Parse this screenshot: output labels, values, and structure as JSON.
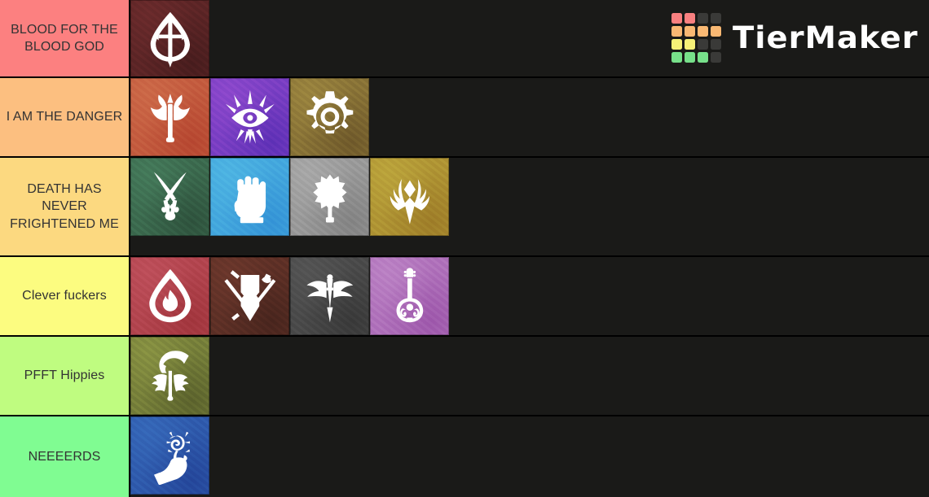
{
  "app": {
    "name": "TierMaker",
    "background_color": "#1a1a18",
    "logo_grid_colors": [
      "#f98080",
      "#f98080",
      "#3a3a38",
      "#3a3a38",
      "#f9b873",
      "#f9b873",
      "#f9b873",
      "#f9b873",
      "#f6f177",
      "#f6f177",
      "#3a3a38",
      "#3a3a38",
      "#77e08a",
      "#77e08a",
      "#77e08a",
      "#3a3a38"
    ]
  },
  "tiers": [
    {
      "label": "BLOOD FOR THE BLOOD GOD",
      "color": "#fc8080",
      "items": [
        {
          "name": "barbarian",
          "bg": "#5d2526",
          "icon": "barbarian"
        }
      ]
    },
    {
      "label": "I AM THE DANGER",
      "color": "#fcbf80",
      "items": [
        {
          "name": "fighter-axe",
          "bg": "#c45c3f",
          "icon": "axe"
        },
        {
          "name": "sorcerer",
          "bg": "#7b3fc4",
          "icon": "sorcerer"
        },
        {
          "name": "artificer",
          "bg": "#8a7437",
          "icon": "gear"
        }
      ]
    },
    {
      "label": "DEATH HAS NEVER FRIGHTENED ME",
      "color": "#fcd980",
      "items": [
        {
          "name": "ranger",
          "bg": "#3c6b4f",
          "icon": "ranger"
        },
        {
          "name": "monk",
          "bg": "#44a8de",
          "icon": "fist"
        },
        {
          "name": "cleric",
          "bg": "#9a9a9a",
          "icon": "mace"
        },
        {
          "name": "paladin",
          "bg": "#b09534",
          "icon": "wings"
        }
      ]
    },
    {
      "label": "Clever fuckers",
      "color": "#fcfc80",
      "items": [
        {
          "name": "warlock",
          "bg": "#b3454f",
          "icon": "flame-drop"
        },
        {
          "name": "fighter",
          "bg": "#5e3026",
          "icon": "shield"
        },
        {
          "name": "rogue",
          "bg": "#4a4a4a",
          "icon": "winged-dagger"
        },
        {
          "name": "bard",
          "bg": "#b072bb",
          "icon": "lute"
        }
      ]
    },
    {
      "label": "PFFT Hippies",
      "color": "#bfFc80",
      "items": [
        {
          "name": "druid",
          "bg": "#77803a",
          "icon": "sickle"
        }
      ]
    },
    {
      "label": "NEEEERDS",
      "color": "#80fc92",
      "items": [
        {
          "name": "wizard",
          "bg": "#2f5bad",
          "icon": "casting-hand"
        }
      ]
    }
  ]
}
